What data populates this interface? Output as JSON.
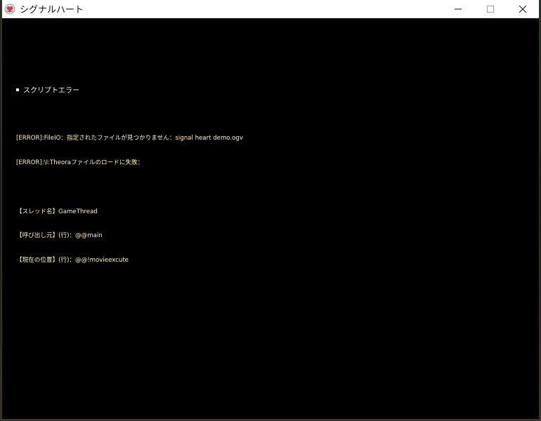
{
  "window": {
    "title": "シグナルハート",
    "app_icon": "heart-app-icon",
    "controls": {
      "minimize_icon": "minimize-icon",
      "maximize_icon": "maximize-icon",
      "close_icon": "close-icon"
    }
  },
  "error_panel": {
    "heading": "スクリプトエラー",
    "errors": [
      "[ERROR]:FileIO：指定されたファイルが見つかりません：signal heart demo.ogv",
      "[ERROR]:\\I:Theoraファイルのロードに失敗："
    ],
    "details": [
      "【スレッド名】GameThread",
      "【呼び出し元】(行)：@@main",
      "【現在の位置】(行)：@@!movieexcute"
    ]
  },
  "colors": {
    "background": "#000000",
    "text": "#fff3b0",
    "titlebar": "#ffffff"
  }
}
